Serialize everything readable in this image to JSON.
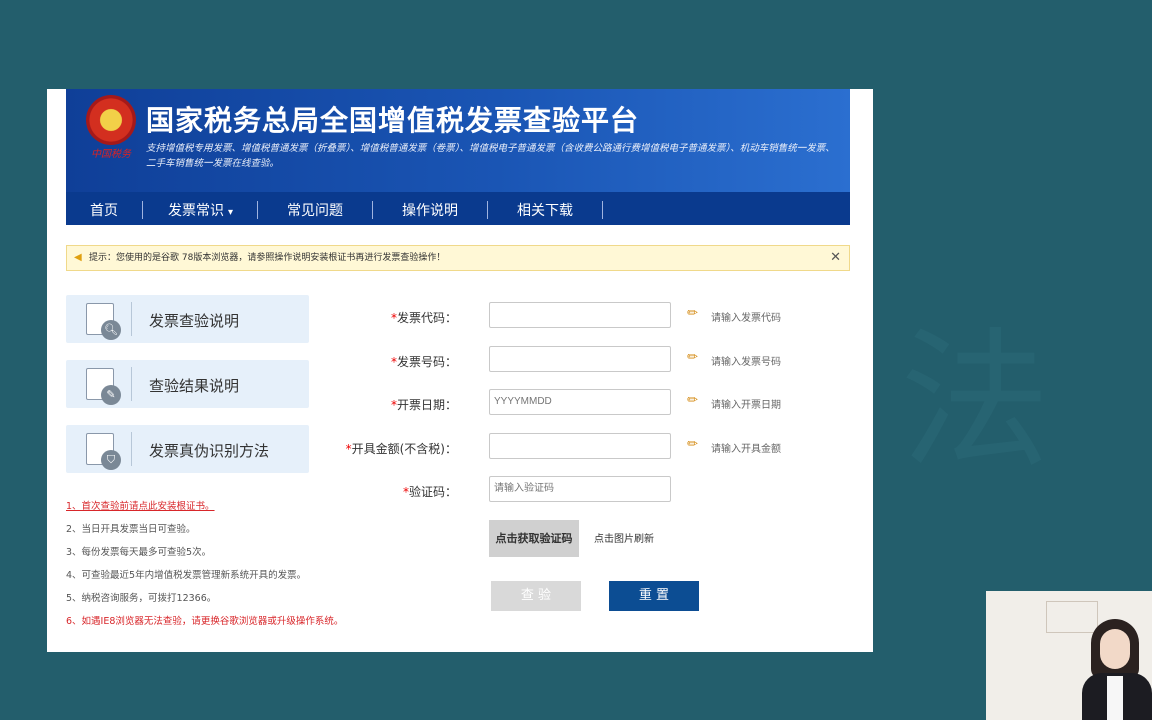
{
  "header": {
    "emblem_text": "中国税务",
    "title": "国家税务总局全国增值税发票查验平台",
    "description": "支持增值税专用发票、增值税普通发票（折叠票）、增值税普通发票（卷票）、增值税电子普通发票（含收费公路通行费增值税电子普通发票）、机动车销售统一发票、二手车销售统一发票在线查验。"
  },
  "nav": {
    "items": [
      "首页",
      "发票常识",
      "常见问题",
      "操作说明",
      "相关下载"
    ]
  },
  "tip": {
    "text": "提示：您使用的是谷歌 78版本浏览器，请参照操作说明安装根证书再进行发票查验操作！"
  },
  "sidebar": {
    "cards": [
      "发票查验说明",
      "查验结果说明",
      "发票真伪识别方法"
    ]
  },
  "notes": [
    "1、首次查验前请点此安装根证书。",
    "2、当日开具发票当日可查验。",
    "3、每份发票每天最多可查验5次。",
    "4、可查验最近5年内增值税发票管理新系统开具的发票。",
    "5、纳税咨询服务，可拨打12366。",
    "6、如遇IE8浏览器无法查验，请更换谷歌浏览器或升级操作系统。"
  ],
  "form": {
    "fields": [
      {
        "label": "发票代码：",
        "placeholder": "",
        "hint": "请输入发票代码"
      },
      {
        "label": "发票号码：",
        "placeholder": "",
        "hint": "请输入发票号码"
      },
      {
        "label": "开票日期：",
        "placeholder": "YYYYMMDD",
        "hint": "请输入开票日期"
      },
      {
        "label": "开具金额(不含税)：",
        "placeholder": "",
        "hint": "请输入开具金额"
      },
      {
        "label": "验证码：",
        "placeholder": "请输入验证码",
        "hint": ""
      }
    ],
    "required_mark": "*",
    "captcha_text": "点击获取验证码",
    "captcha_hint": "点击图片刷新",
    "check_button": "查 验",
    "reset_button": "重 置"
  },
  "colors": {
    "page_background": "#235e6c",
    "header_blue": "#1a55b4",
    "nav_blue": "#0a3a8e",
    "reset_button": "#0c4d93",
    "note_red": "#d8262a"
  }
}
